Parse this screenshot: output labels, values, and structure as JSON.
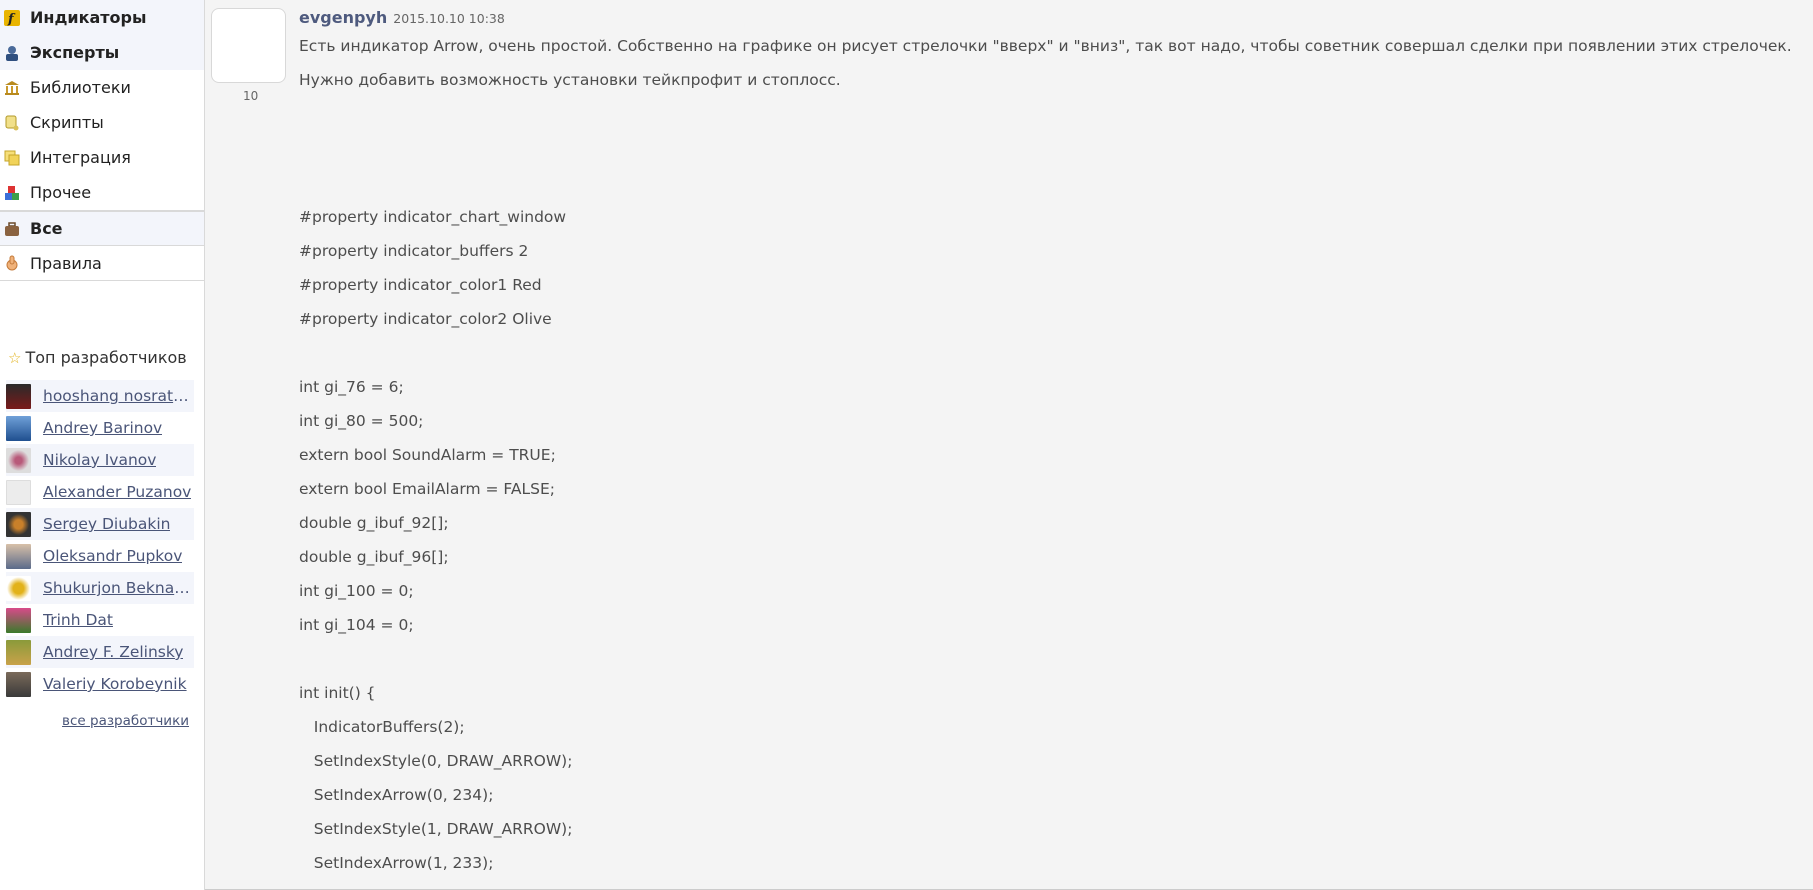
{
  "sidebar": {
    "categories": [
      {
        "label": "Индикаторы",
        "icon": "function-icon",
        "bold": true
      },
      {
        "label": "Эксперты",
        "icon": "advisor-icon",
        "bold": true
      },
      {
        "label": "Библиотеки",
        "icon": "library-icon",
        "bold": false
      },
      {
        "label": "Скрипты",
        "icon": "scroll-icon",
        "bold": false
      },
      {
        "label": "Интеграция",
        "icon": "integration-icon",
        "bold": false
      },
      {
        "label": "Прочее",
        "icon": "cubes-icon",
        "bold": false
      }
    ],
    "all_label": "Все",
    "rules_label": "Правила",
    "top_developers_title": "Топ разработчиков",
    "developers": [
      "hooshang nosratpa...",
      "Andrey Barinov",
      "Nikolay Ivanov",
      "Alexander Puzanov",
      "Sergey Diubakin",
      "Oleksandr Pupkov",
      "Shukurjon Beknaza...",
      "Trinh Dat",
      "Andrey F. Zelinsky",
      "Valeriy Korobeynik"
    ],
    "all_developers_link": "все разработчики"
  },
  "post": {
    "rating": "10",
    "author": "evgenpyh",
    "date": "2015.10.10 10:38",
    "paragraph1": "Есть индикатор Arrow, очень простой. Собственно на графике он рисует стрелочки \"вверх\" и \"вниз\", так вот надо, чтобы советник совершал сделки при появлении этих стрелочек.",
    "paragraph2": "Нужно добавить возможность установки тейкпрофит и стоплосс.",
    "code_lines": [
      "#property indicator_chart_window",
      "#property indicator_buffers 2",
      "#property indicator_color1 Red",
      "#property indicator_color2 Olive",
      "",
      "int gi_76 = 6;",
      "int gi_80 = 500;",
      "extern bool SoundAlarm = TRUE;",
      "extern bool EmailAlarm = FALSE;",
      "double g_ibuf_92[];",
      "double g_ibuf_96[];",
      "int gi_100 = 0;",
      "int gi_104 = 0;",
      "",
      "int init() {",
      "   IndicatorBuffers(2);",
      "   SetIndexStyle(0, DRAW_ARROW);",
      "   SetIndexArrow(0, 234);",
      "   SetIndexStyle(1, DRAW_ARROW);",
      "   SetIndexArrow(1, 233);"
    ]
  },
  "colors": {
    "link": "#4a5578",
    "author": "#4e5a7e",
    "text": "#4d4d4d",
    "page_bg": "#f4f4f4"
  }
}
